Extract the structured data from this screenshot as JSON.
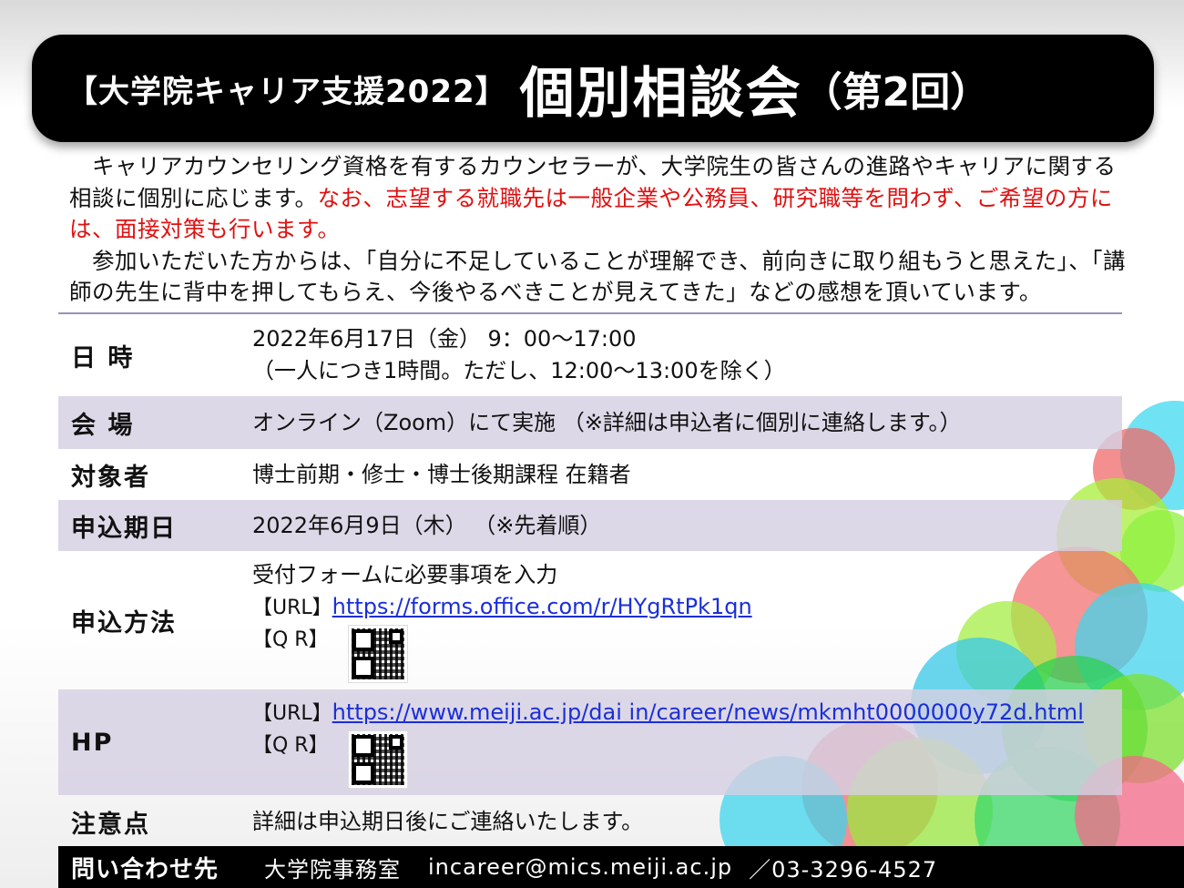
{
  "title": {
    "prefix": "【大学院キャリア支援2022】",
    "main": "個別相談会",
    "suffix": "（第2回）"
  },
  "intro": {
    "p1_black": "キャリアカウンセリング資格を有するカウンセラーが、大学院生の皆さんの進路やキャリアに関する相談に個別に応じます。",
    "p1_red": "なお、志望する就職先は一般企業や公務員、研究職等を問わず、ご希望の方には、面接対策も行います。",
    "p2": "参加いただいた方からは、「自分に不足していることが理解でき、前向きに取り組もうと思えた」、「講師の先生に背中を押してもらえ、今後やるべきことが見えてきた」などの感想を頂いています。"
  },
  "rows": {
    "datetime": {
      "label": "日 時",
      "line1": "2022年6月17日（金） 9：00～17:00",
      "line2": "（一人につき1時間。ただし、12:00～13:00を除く）"
    },
    "venue": {
      "label": "会 場",
      "value": "オンライン（Zoom）にて実施 （※詳細は申込者に個別に連絡します。）"
    },
    "target": {
      "label": "対象者",
      "value": "博士前期・修士・博士後期課程 在籍者"
    },
    "deadline": {
      "label": "申込期日",
      "value": "2022年6月9日（木） （※先着順）"
    },
    "method": {
      "label": "申込方法",
      "line1": "受付フォームに必要事項を入力",
      "url_tag": "【URL】",
      "url": "https://forms.office.com/r/HYgRtPk1qn",
      "qr_tag": "【Q R】"
    },
    "hp": {
      "label": "HP",
      "url_tag": "【URL】",
      "url": "https://www.meiji.ac.jp/dai in/career/news/mkmht0000000y72d.html",
      "qr_tag": "【Q R】"
    },
    "notes": {
      "label": "注意点",
      "value": "詳細は申込期日後にご連絡いたします。"
    }
  },
  "footer": {
    "label": "問い合わせ先",
    "office": "大学院事務室",
    "email": "incareer@mics.meiji.ac.jp",
    "phone": "／03-3296-4527"
  },
  "colors": {
    "title_bg": "#000000",
    "red_text": "#e01010",
    "link": "#1a2fd8",
    "row_shade": "#d6d0e2"
  }
}
